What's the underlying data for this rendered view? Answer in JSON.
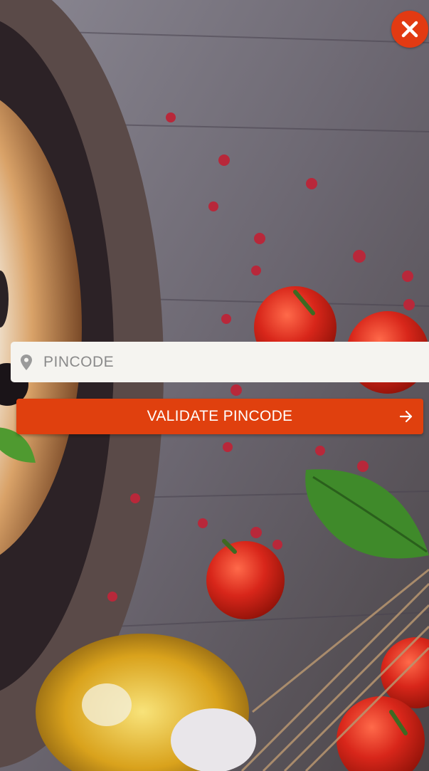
{
  "background": {
    "image_icon": "food-photo-background",
    "colors": {
      "wood": "#6e6a72",
      "tomato": "#d8261a",
      "basil": "#3f8a2a",
      "oil": "#d9a21c"
    }
  },
  "close_button": {
    "icon": "close-icon",
    "color": "#e23a12"
  },
  "pincode": {
    "placeholder": "PINCODE",
    "value": "",
    "icon": "map-pin-icon"
  },
  "validate_button": {
    "label": "VALIDATE PINCODE",
    "icon": "arrow-right-icon",
    "color": "#e0400e"
  }
}
